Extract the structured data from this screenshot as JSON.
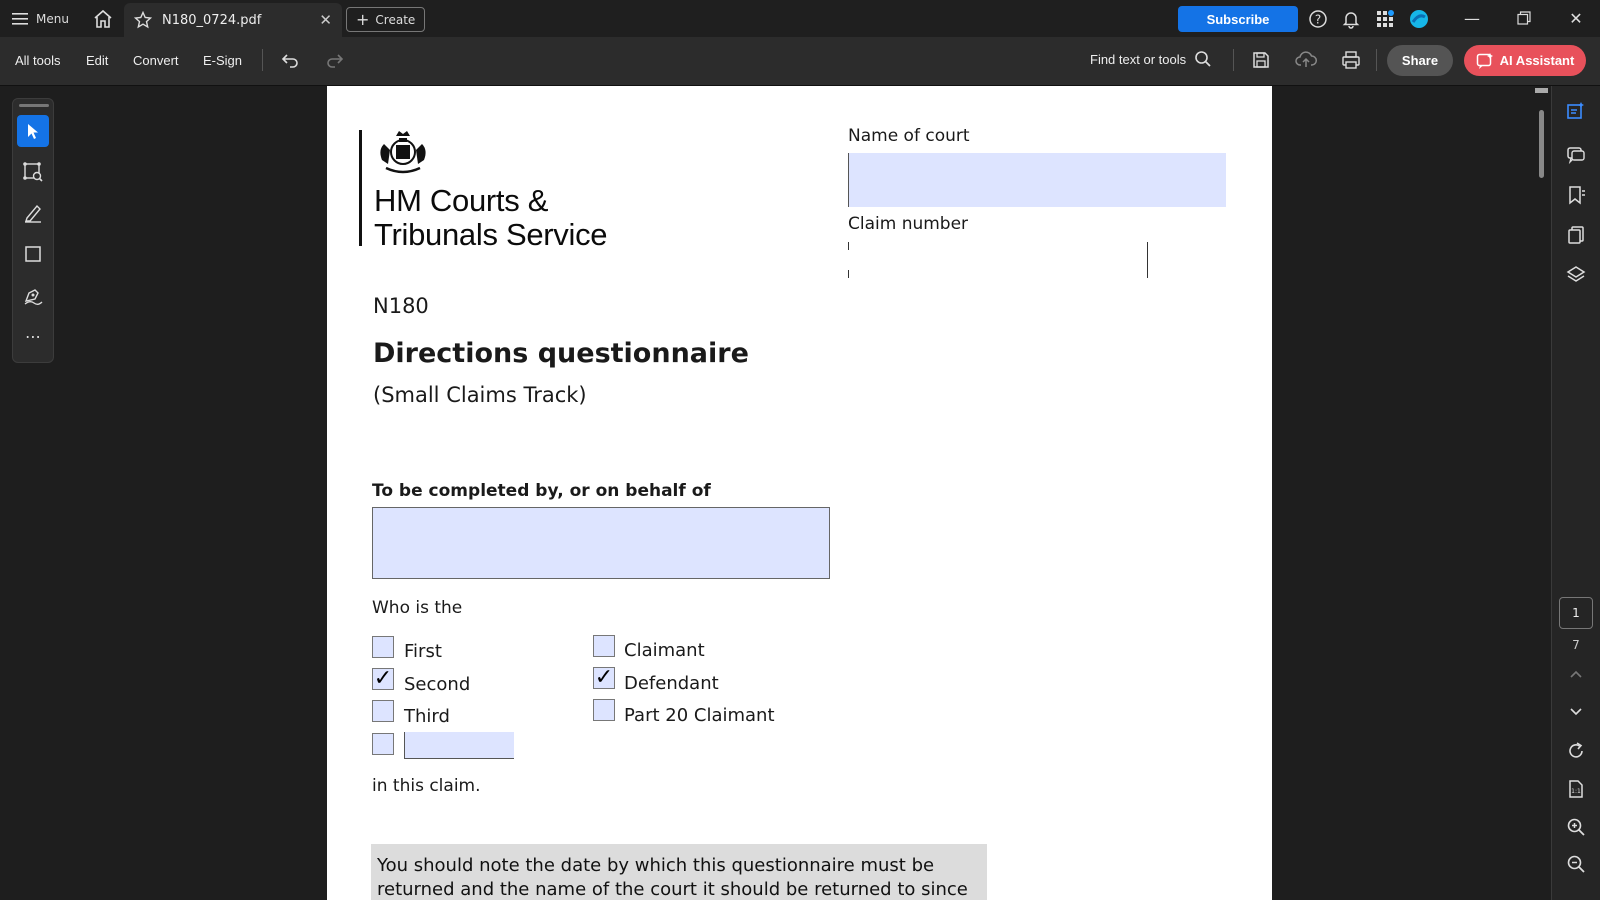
{
  "titlebar": {
    "menu_label": "Menu",
    "tab_title": "N180_0724.pdf",
    "create_label": "Create",
    "subscribe_label": "Subscribe"
  },
  "toolbar": {
    "tabs": [
      "All tools",
      "Edit",
      "Convert",
      "E-Sign"
    ],
    "find_label": "Find text or tools",
    "share_label": "Share",
    "ai_label": "AI Assistant"
  },
  "navigation": {
    "current_page": "1",
    "total_pages": "7"
  },
  "document": {
    "org_line1": "HM Courts &",
    "org_line2": "Tribunals Service",
    "name_of_court_label": "Name of court",
    "claim_number_label": "Claim number",
    "form_code": "N180",
    "title": "Directions questionnaire",
    "subtitle": "(Small Claims Track)",
    "completed_by_label": "To be completed by, or on behalf of",
    "who_is_label": "Who is the",
    "party_order_options": [
      {
        "label": "First",
        "checked": false
      },
      {
        "label": "Second",
        "checked": true
      },
      {
        "label": "Third",
        "checked": false
      }
    ],
    "party_role_options": [
      {
        "label": "Claimant",
        "checked": false
      },
      {
        "label": "Defendant",
        "checked": true
      },
      {
        "label": "Part 20 Claimant",
        "checked": false
      }
    ],
    "in_claim_label": "in this claim.",
    "notice_line1": "You should note the date by which this questionnaire must be",
    "notice_line2": "returned and the name of the court it should be returned to since this"
  },
  "colors": {
    "accent": "#1473e6",
    "ai_button": "#e8515b",
    "form_field": "#dde4ff"
  }
}
